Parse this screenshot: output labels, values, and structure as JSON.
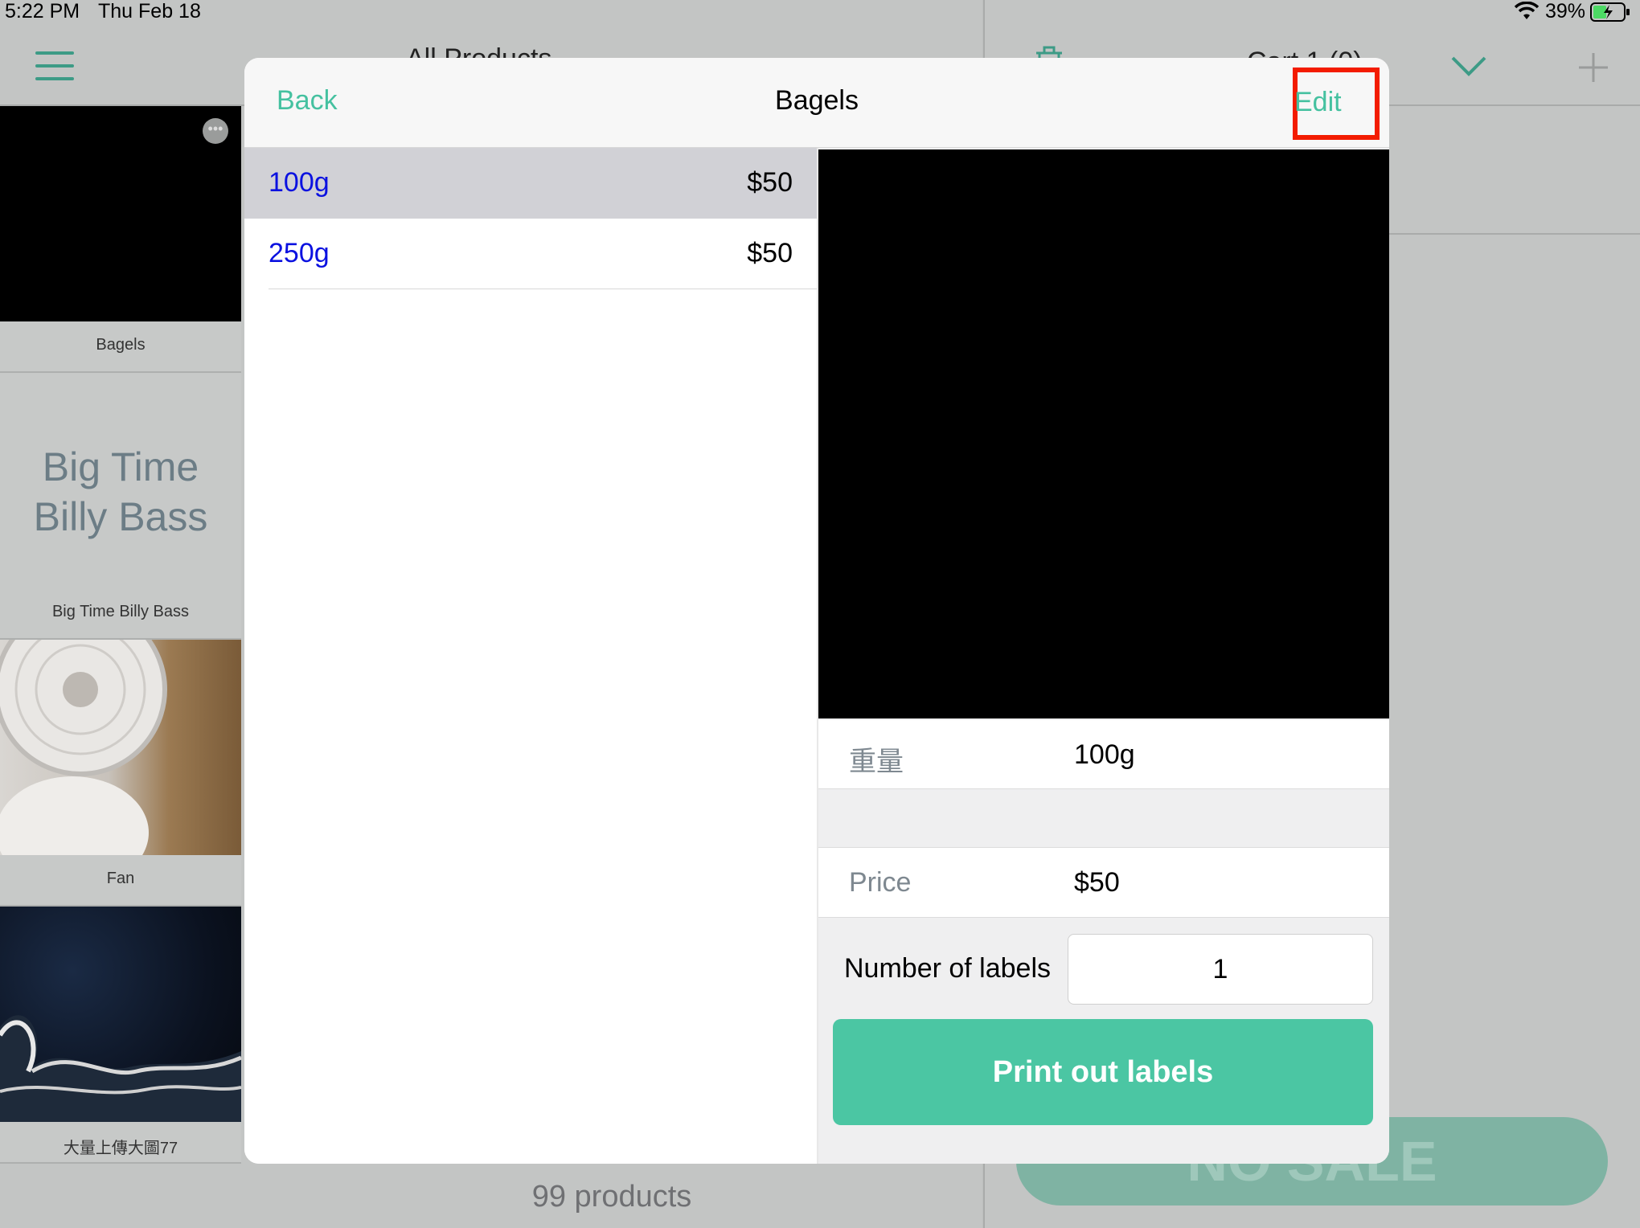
{
  "status_bar": {
    "time": "5:22 PM",
    "date": "Thu Feb 18",
    "battery_percent": "39%",
    "wifi_icon": "wifi-icon",
    "battery_icon": "battery-charging-icon"
  },
  "background": {
    "products_header": "All Products",
    "cart_header": "Cart 1 (0)",
    "tiles": [
      {
        "label": "Bagels"
      },
      {
        "label": "Big Time Billy Bass",
        "big_name": "Big Time Billy Bass"
      },
      {
        "label": "Fan"
      },
      {
        "label": "大量上傳大圖77"
      }
    ],
    "product_count": "99 products",
    "no_sale_label": "NO SALE"
  },
  "modal": {
    "back_label": "Back",
    "title": "Bagels",
    "edit_label": "Edit",
    "variants": [
      {
        "name": "100g",
        "price": "$50",
        "selected": true
      },
      {
        "name": "250g",
        "price": "$50",
        "selected": false
      }
    ],
    "attributes": {
      "weight_label": "重量",
      "weight_value": "100g",
      "price_label": "Price",
      "price_value": "$50"
    },
    "labels_count_label": "Number of labels",
    "labels_count_value": "1",
    "print_button_label": "Print out labels"
  },
  "colors": {
    "accent": "#45c1a0",
    "highlight_box": "#f31c00",
    "variant_text": "#0b11e0",
    "print_button": "#4bc6a3"
  }
}
